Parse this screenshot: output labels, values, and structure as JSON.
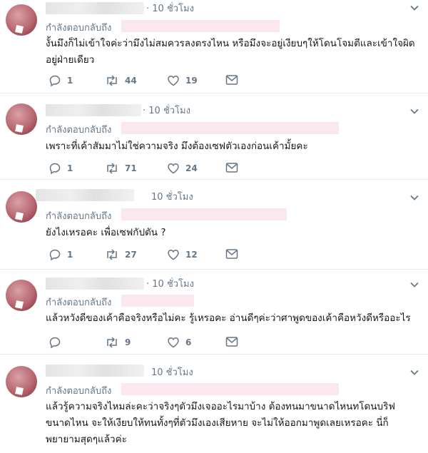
{
  "replying_label": "กำลังตอบกลับถึง",
  "tweets": [
    {
      "time": "· 10 ชั่วโมง",
      "text": "งั้นมึงก็ไม่เข้าใจค่ะว่ามึงไม่สมควรลงตรงไหน หรือมึงจะอยู่เงียบๆให้โดนโจมตีและเข้าใจผิดอยู่ฝ่ายเดียว",
      "replies": "1",
      "retweets": "44",
      "likes": "19"
    },
    {
      "time": "· 10 ชั่วโมง",
      "text": "เพราะที่เค้าสัมมาไม่ใช่ความจริง มึงต้องเซฟตัวเองก่อนเค้ามั้ยคะ",
      "replies": "1",
      "retweets": "71",
      "likes": "24"
    },
    {
      "time": "10 ชั่วโมง",
      "text": "ยังไงเหรอคะ เพื่อเซฟกัปตัน ?",
      "replies": "1",
      "retweets": "27",
      "likes": "12"
    },
    {
      "time": "· 10 ชั่วโมง",
      "text": "แล้วหวังดีของเค้าคือจริงหรือไม่คะ รู้เหรอคะ อ่านดีๆค่ะว่าศาพูดของเค้าคือหวังดีหรืออะไร",
      "replies": "",
      "retweets": "9",
      "likes": "6"
    },
    {
      "time": "10 ชั่วโมง",
      "text": "แล้วรู้ความจริงไหมล่ะคะว่าจริงๆตัวมึงเจออะไรมาบ้าง ต้องทนมาขนาดไหนทโดนบริฟขนาดไหน จะให้เงียบให้ทนทั้งๆที่ตัวมึงเองเสียหาย จะไม่ให้ออกมาพูดเลยเหรอคะ นี่ก็พยายามสุดๆแล้วค่ะ",
      "replies": "",
      "retweets": "",
      "likes": ""
    }
  ]
}
